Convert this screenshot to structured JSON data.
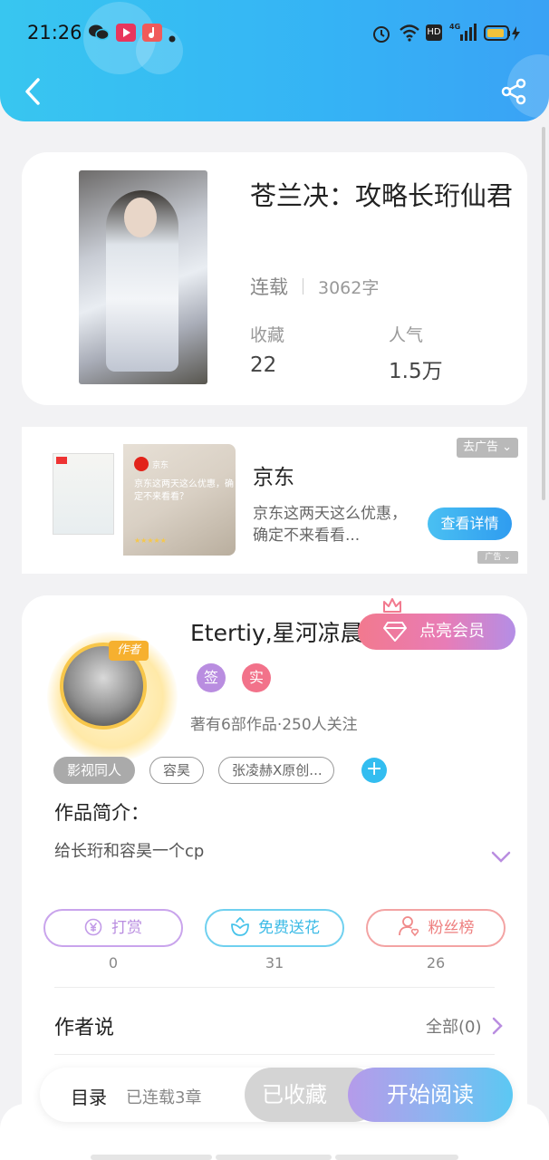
{
  "status_bar": {
    "time": "21:26",
    "icons": [
      "wechat-icon",
      "video-app-icon",
      "music-app-icon",
      "dot-icon",
      "alarm-icon",
      "wifi-icon",
      "hd-icon",
      "signal-4g-icon",
      "battery-icon"
    ],
    "hd_label": "HD",
    "net_label": "4G"
  },
  "nav": {
    "back_icon": "back-arrow-icon",
    "share_icon": "share-icon"
  },
  "book": {
    "title": "苍兰决：攻略长珩仙君",
    "status": "连载",
    "word_count": "3062字",
    "favorites_label": "收藏",
    "favorites_value": "22",
    "popularity_label": "人气",
    "popularity_value": "1.5万"
  },
  "ad": {
    "brand_small": "京东",
    "slogan": "京东这两天这么优惠，确定不来看看？",
    "stars": "★★★★★",
    "name": "京东",
    "description": "京东这两天这么优惠，确定不来看看...",
    "detail_button": "查看详情",
    "close_label": "去广告 ⌄",
    "ad_mark": "广告 ⌄"
  },
  "author": {
    "badge": "作者",
    "name": "Etertiy,星河凉晨",
    "vip_button": "点亮会员",
    "sign_tag": "签",
    "real_tag": "实",
    "meta": "著有6部作品·250人关注",
    "tags": [
      "影视同人",
      "容昊",
      "张凌赫X原创..."
    ],
    "add_tag": "+",
    "colors": {
      "sign": "#b98de0",
      "real": "#f2728a"
    }
  },
  "intro": {
    "label": "作品简介：",
    "text": "给长珩和容昊一个cp"
  },
  "actions": [
    {
      "label": "打赏",
      "count": "0",
      "icon": "yen-icon",
      "color": "#c29be8"
    },
    {
      "label": "免费送花",
      "count": "31",
      "icon": "flower-icon",
      "color": "#47c3ea"
    },
    {
      "label": "粉丝榜",
      "count": "26",
      "icon": "fans-icon",
      "color": "#f08a8a"
    }
  ],
  "author_says": {
    "label": "作者说",
    "all": "全部(0)"
  },
  "bottom": {
    "toc": "目录",
    "toc_sub": "已连载3章",
    "favorited": "已收藏",
    "start_reading": "开始阅读"
  }
}
